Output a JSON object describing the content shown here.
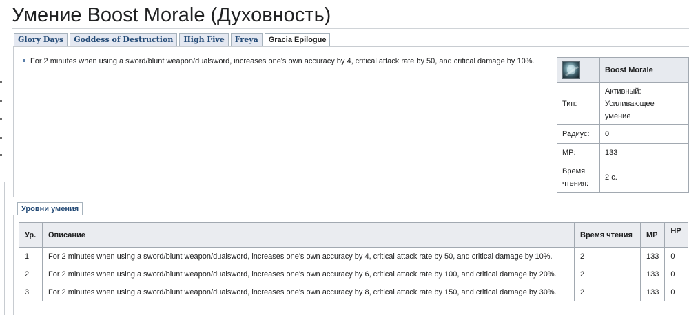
{
  "page": {
    "title": "Умение Boost Morale (Духовность)"
  },
  "version_tabs": [
    {
      "label": "Glory Days",
      "active": false
    },
    {
      "label": "Goddess of Destruction",
      "active": false
    },
    {
      "label": "High Five",
      "active": false
    },
    {
      "label": "Freya",
      "active": false
    },
    {
      "label": "Gracia Epilogue",
      "active": true
    }
  ],
  "description": "For 2 minutes when using a sword/blunt weapon/dualsword, increases one's own accuracy by 4, critical attack rate by 50, and critical damage by 10%.",
  "infobox": {
    "icon": "boost-morale-skill-icon",
    "name": "Boost Morale",
    "type_label": "Тип:",
    "type_value_1": "Активный:",
    "type_value_2": "Усиливающее",
    "type_value_3": "умение",
    "radius_label": "Радиус:",
    "radius_value": "0",
    "mp_label": "MP:",
    "mp_value": "133",
    "cast_label_1": "Время",
    "cast_label_2": "чтения:",
    "cast_value": "2 с."
  },
  "levels_tab": {
    "label": "Уровни умения"
  },
  "levels_table": {
    "headers": {
      "level": "Ур.",
      "description": "Описание",
      "cast_time": "Время чтения",
      "mp": "MP",
      "hp": "HP"
    },
    "rows": [
      {
        "level": "1",
        "description": "For 2 minutes when using a sword/blunt weapon/dualsword, increases one's own accuracy by 4, critical attack rate by 50, and critical damage by 10%.",
        "cast_time": "2",
        "mp": "133",
        "hp": "0"
      },
      {
        "level": "2",
        "description": "For 2 minutes when using a sword/blunt weapon/dualsword, increases one's own accuracy by 6, critical attack rate by 100, and critical damage by 20%.",
        "cast_time": "2",
        "mp": "133",
        "hp": "0"
      },
      {
        "level": "3",
        "description": "For 2 minutes when using a sword/blunt weapon/dualsword, increases one's own accuracy by 8, critical attack rate by 150, and critical damage by 30%.",
        "cast_time": "2",
        "mp": "133",
        "hp": "0"
      }
    ]
  },
  "colors": {
    "tab_bg": "#e4e8f1",
    "link": "#234a76",
    "table_header_bg": "#eaecf0",
    "border": "#a2a9b1"
  }
}
